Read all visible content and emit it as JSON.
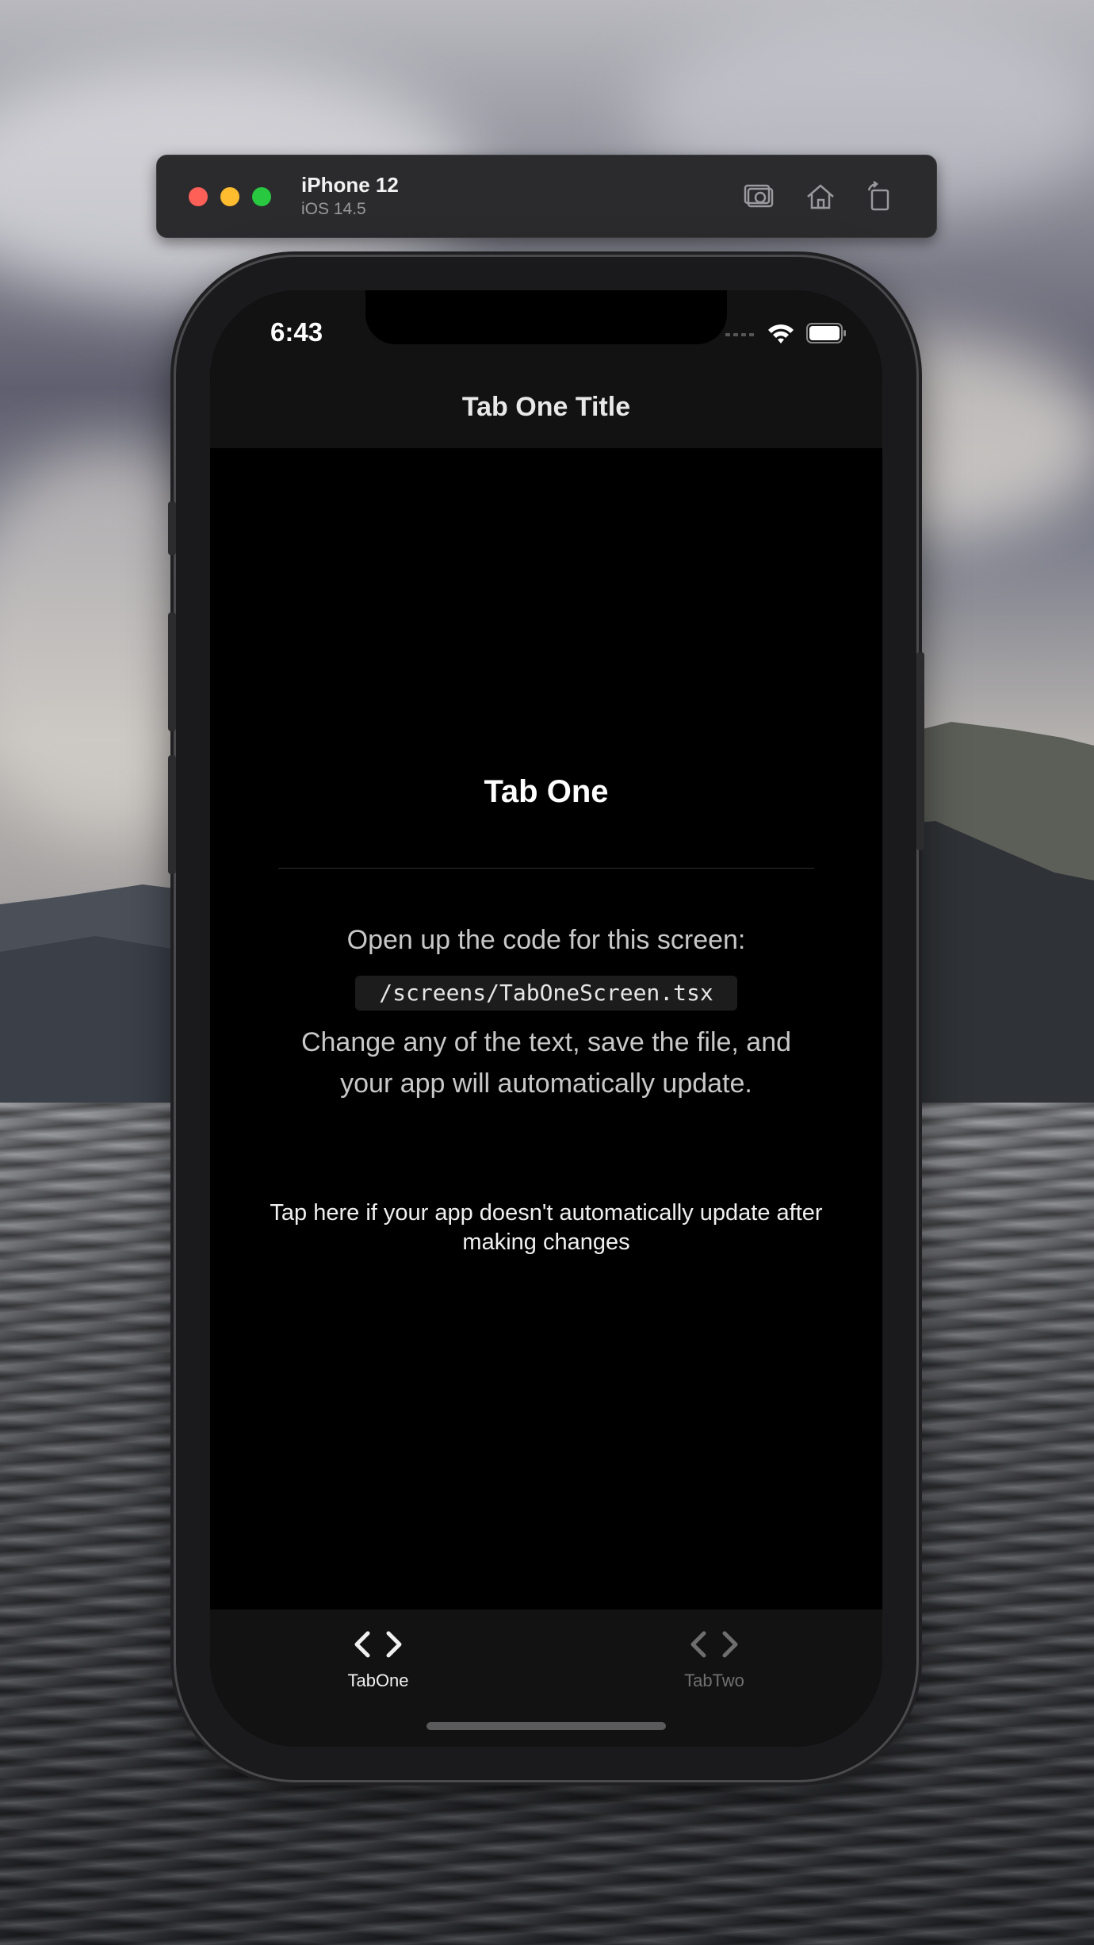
{
  "simulator": {
    "device_name": "iPhone 12",
    "os_version": "iOS 14.5",
    "tools": [
      "screenshot-icon",
      "home-icon",
      "rotate-icon"
    ]
  },
  "status_bar": {
    "time": "6:43"
  },
  "nav": {
    "title": "Tab One Title"
  },
  "content": {
    "heading": "Tab One",
    "open_code": "Open up the code for this screen:",
    "code_path": "/screens/TabOneScreen.tsx",
    "change_text": "Change any of the text, save the file, and your app will automatically update.",
    "help_link": "Tap here if your app doesn't automatically update after making changes"
  },
  "tabbar": {
    "tabs": [
      {
        "label": "TabOne",
        "icon": "code-icon",
        "active": true
      },
      {
        "label": "TabTwo",
        "icon": "code-icon",
        "active": false
      }
    ]
  },
  "colors": {
    "traffic_red": "#fe5f57",
    "traffic_yellow": "#febc2e",
    "traffic_green": "#28c840",
    "screen_background": "#000000",
    "header_background": "#121212"
  }
}
